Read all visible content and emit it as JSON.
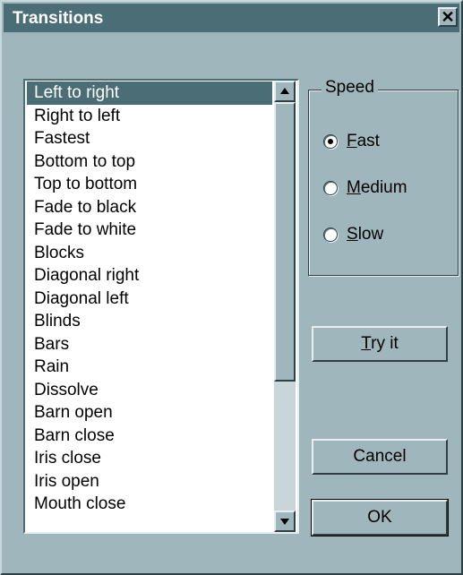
{
  "window": {
    "title": "Transitions",
    "close_glyph": "✕"
  },
  "list": {
    "selected_index": 0,
    "items": [
      "Left to right",
      "Right to left",
      "Fastest",
      "Bottom to top",
      "Top to bottom",
      "Fade to black",
      "Fade to white",
      "Blocks",
      "Diagonal right",
      "Diagonal left",
      "Blinds",
      "Bars",
      "Rain",
      "Dissolve",
      "Barn open",
      "Barn close",
      "Iris close",
      "Iris open",
      "Mouth close"
    ]
  },
  "speed": {
    "label": "Speed",
    "options": [
      {
        "mnemonic": "F",
        "rest": "ast",
        "selected": true
      },
      {
        "mnemonic": "M",
        "rest": "edium",
        "selected": false
      },
      {
        "mnemonic": "S",
        "rest": "low",
        "selected": false
      }
    ]
  },
  "buttons": {
    "try_it": {
      "mnemonic": "T",
      "rest": "ry it"
    },
    "cancel": "Cancel",
    "ok": "OK"
  },
  "colors": {
    "face": "#9fb6bd",
    "title_bar": "#4b6d75",
    "selection": "#4b6d75"
  }
}
